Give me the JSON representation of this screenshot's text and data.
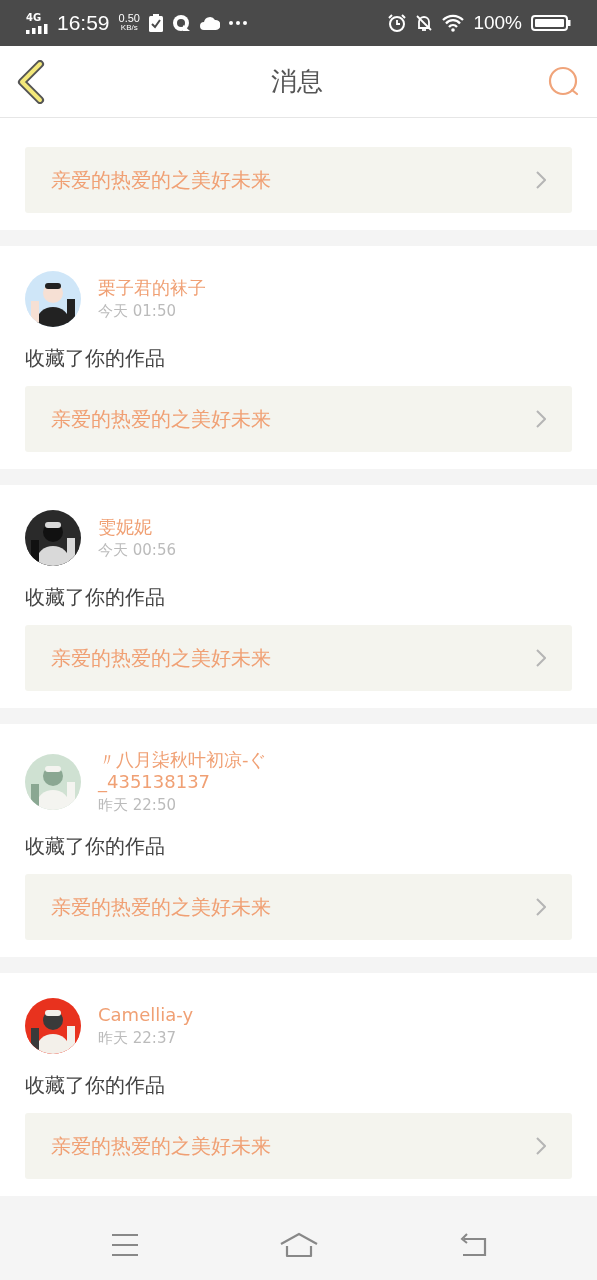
{
  "status_bar": {
    "network": "4G",
    "time": "16:59",
    "speed": "0.50",
    "speed_unit": "KB/s",
    "battery": "100%"
  },
  "header": {
    "title": "消息"
  },
  "messages": [
    {
      "work": "亲爱的热爱的之美好未来"
    },
    {
      "name": "栗子君的袜子",
      "time": "今天 01:50",
      "action": "收藏了你的作品",
      "work": "亲爱的热爱的之美好未来"
    },
    {
      "name": "雯妮妮",
      "time": "今天 00:56",
      "action": "收藏了你的作品",
      "work": "亲爱的热爱的之美好未来"
    },
    {
      "name": "〃八月柒秋叶初凉-ぐ_435138137",
      "time": "昨天 22:50",
      "action": "收藏了你的作品",
      "work": "亲爱的热爱的之美好未来"
    },
    {
      "name": "Camellia-y",
      "time": "昨天 22:37",
      "action": "收藏了你的作品",
      "work": "亲爱的热爱的之美好未来"
    }
  ]
}
